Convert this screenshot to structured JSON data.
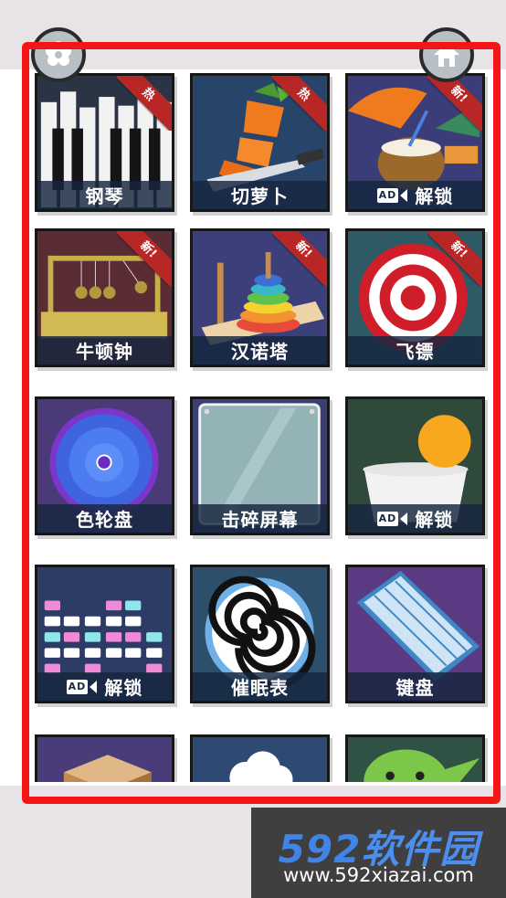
{
  "top_bar": {
    "settings_button": "settings-icon",
    "home_button": "home-icon"
  },
  "ribbons": {
    "hot": "热",
    "new": "新!"
  },
  "ad_badge": {
    "text": "AD"
  },
  "tiles": [
    {
      "label": "钢琴",
      "ribbon": "热",
      "locked": false
    },
    {
      "label": "切萝卜",
      "ribbon": "热",
      "locked": false
    },
    {
      "label": "解锁",
      "ribbon": "新!",
      "locked": true
    },
    {
      "label": "牛顿钟",
      "ribbon": "新!",
      "locked": false
    },
    {
      "label": "汉诺塔",
      "ribbon": "新!",
      "locked": false
    },
    {
      "label": "飞镖",
      "ribbon": "新!",
      "locked": false
    },
    {
      "label": "色轮盘",
      "ribbon": "",
      "locked": false
    },
    {
      "label": "击碎屏幕",
      "ribbon": "",
      "locked": false
    },
    {
      "label": "解锁",
      "ribbon": "",
      "locked": true
    },
    {
      "label": "解锁",
      "ribbon": "",
      "locked": true
    },
    {
      "label": "催眠表",
      "ribbon": "",
      "locked": false
    },
    {
      "label": "键盘",
      "ribbon": "",
      "locked": false
    }
  ],
  "watermark": {
    "logo_digits": "592",
    "logo_text": "软件园",
    "url": "www.592xiazai.com"
  },
  "colors": {
    "highlight_frame": "#f41516",
    "ribbon": "#b92626",
    "label_bar": "#16263e"
  }
}
